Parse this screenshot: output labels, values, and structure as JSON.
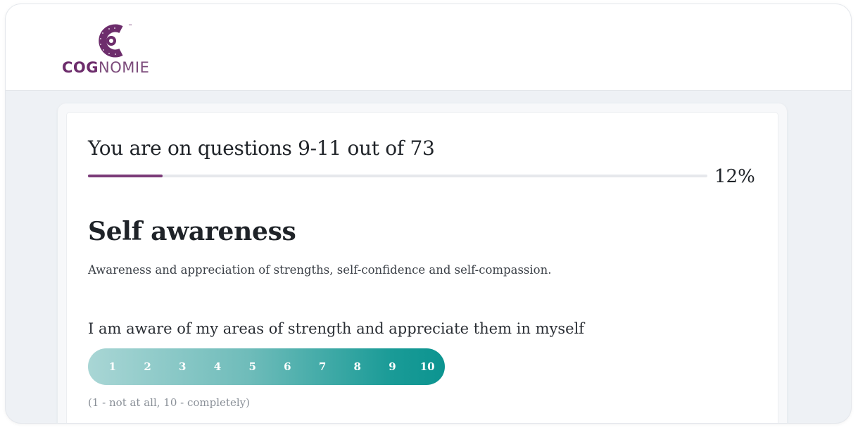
{
  "brand": {
    "name_bold": "COG",
    "name_light": "NOMIE",
    "trademark": "™",
    "primary_color": "#6d2d6c"
  },
  "progress": {
    "title": "You are on questions 9-11 out of 73",
    "percent_label": "12%",
    "percent_value": 12,
    "fill_color": "#7b3b78"
  },
  "section": {
    "title": "Self awareness",
    "description": "Awareness and appreciation of strengths, self-confidence and self-compassion."
  },
  "question": {
    "text": "I am aware of my areas of strength and appreciate them in myself",
    "scale": [
      "1",
      "2",
      "3",
      "4",
      "5",
      "6",
      "7",
      "8",
      "9",
      "10"
    ],
    "scale_hint": "(1 - not at all, 10 - completely)",
    "scale_color_start": "#a9d6d5",
    "scale_color_end": "#0c9490"
  }
}
